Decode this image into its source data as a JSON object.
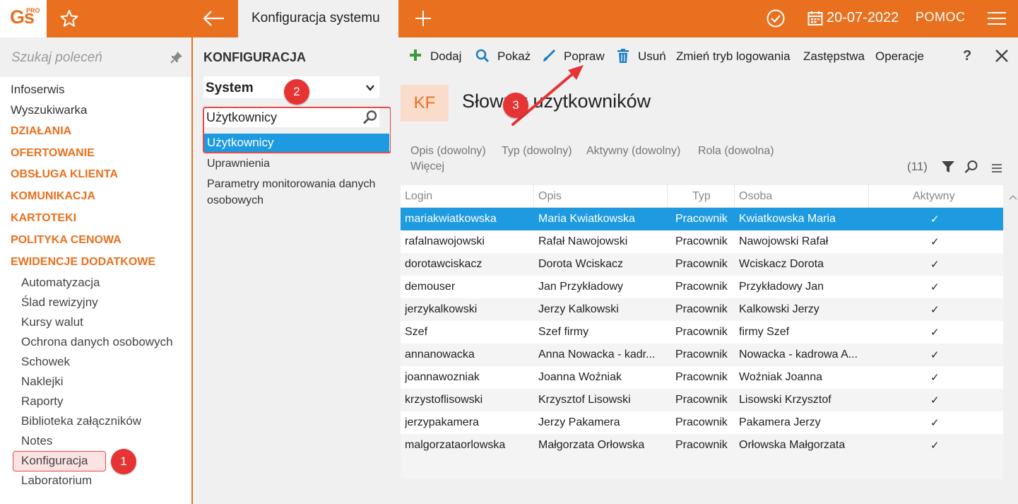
{
  "app": {
    "logo_text": "Gs",
    "logo_suffix": "PRO",
    "active_tab": "Konfiguracja systemu",
    "date": "20-07-2022",
    "help": "POMOC"
  },
  "sidebar": {
    "search_placeholder": "Szukaj poleceń",
    "top_items": [
      "Infoserwis",
      "Wyszukiwarka"
    ],
    "categories": [
      "DZIAŁANIA",
      "OFERTOWANIE",
      "OBSŁUGA KLIENTA",
      "KOMUNIKACJA",
      "KARTOTEKI",
      "POLITYKA CENOWA",
      "EWIDENCJE DODATKOWE"
    ],
    "sub_items": [
      "Automatyzacja",
      "Ślad rewizyjny",
      "Kursy walut",
      "Ochrona danych osobowych",
      "Schowek",
      "Naklejki",
      "Raporty",
      "Biblioteka załączników",
      "Notes",
      "Konfiguracja",
      "Laboratorium"
    ]
  },
  "middle": {
    "title": "KONFIGURACJA",
    "select_value": "System",
    "search_value": "Użytkownicy",
    "selected_item": "Użytkownicy",
    "items": [
      "Uprawnienia",
      "Parametry monitorowania danych",
      "osobowych"
    ]
  },
  "toolbar": {
    "add": "Dodaj",
    "show": "Pokaż",
    "edit": "Popraw",
    "delete": "Usuń",
    "change_login": "Zmień tryb logowania",
    "substitutes": "Zastępstwa",
    "operations": "Operacje",
    "help": "?"
  },
  "page": {
    "badge": "KF",
    "title": "Słownik użytkowników"
  },
  "filters": {
    "items": [
      "Opis (dowolny)",
      "Typ (dowolny)",
      "Aktywny (dowolny)",
      "Rola (dowolna)"
    ],
    "more": "Więcej",
    "count": "(11)"
  },
  "table": {
    "columns": [
      "Login",
      "Opis",
      "Typ",
      "Osoba",
      "Aktywny"
    ],
    "rows": [
      [
        "mariakwiatkowska",
        "Maria Kwiatkowska",
        "Pracownik",
        "Kwiatkowska Maria",
        "✓"
      ],
      [
        "rafalnawojowski",
        "Rafał Nawojowski",
        "Pracownik",
        "Nawojowski Rafał",
        "✓"
      ],
      [
        "dorotawciskacz",
        "Dorota Wciskacz",
        "Pracownik",
        "Wciskacz Dorota",
        "✓"
      ],
      [
        "demouser",
        "Jan Przykładowy",
        "Pracownik",
        "Przykładowy Jan",
        "✓"
      ],
      [
        "jerzykalkowski",
        "Jerzy Kalkowski",
        "Pracownik",
        "Kalkowski Jerzy",
        "✓"
      ],
      [
        "Szef",
        "Szef firmy",
        "Pracownik",
        "firmy Szef",
        "✓"
      ],
      [
        "annanowacka",
        "Anna Nowacka - kadr...",
        "Pracownik",
        "Nowacka - kadrowa A...",
        "✓"
      ],
      [
        "joannawozniak",
        "Joanna Woźniak",
        "Pracownik",
        "Woźniak Joanna",
        "✓"
      ],
      [
        "krzystoflisowski",
        "Krzysztof Lisowski",
        "Pracownik",
        "Lisowski Krzysztof",
        "✓"
      ],
      [
        "jerzypakamera",
        "Jerzy Pakamera",
        "Pracownik",
        "Pakamera Jerzy",
        "✓"
      ],
      [
        "malgorzataorlowska",
        "Małgorzata Orłowska",
        "Pracownik",
        "Orłowska Małgorzata",
        "✓"
      ]
    ]
  },
  "annotations": {
    "step1": "1",
    "step2": "2",
    "step3": "3"
  },
  "colors": {
    "brand_orange": "#e8701e",
    "selection_blue": "#1e9be0",
    "annotation_red": "#e63333"
  }
}
